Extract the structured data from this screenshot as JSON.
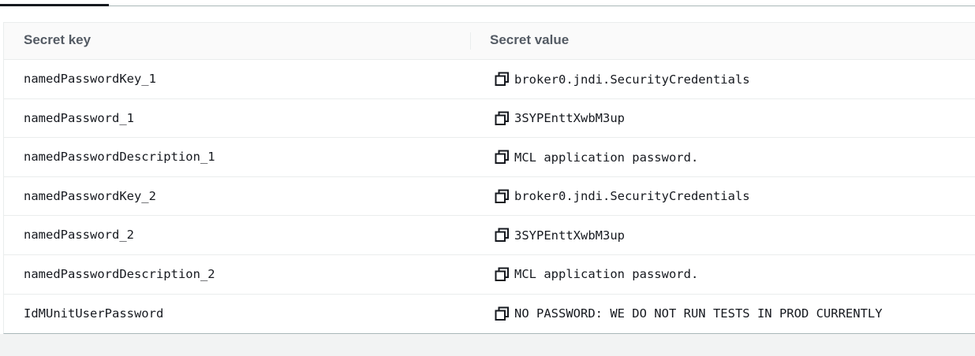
{
  "table": {
    "headers": {
      "key": "Secret key",
      "value": "Secret value"
    },
    "rows": [
      {
        "key": "namedPasswordKey_1",
        "value": "broker0.jndi.SecurityCredentials"
      },
      {
        "key": "namedPassword_1",
        "value": "3SYPEnttXwbM3up"
      },
      {
        "key": "namedPasswordDescription_1",
        "value": "MCL application password."
      },
      {
        "key": "namedPasswordKey_2",
        "value": "broker0.jndi.SecurityCredentials"
      },
      {
        "key": "namedPassword_2",
        "value": "3SYPEnttXwbM3up"
      },
      {
        "key": "namedPasswordDescription_2",
        "value": "MCL application password."
      },
      {
        "key": "IdMUnitUserPassword",
        "value": "NO PASSWORD: WE DO NOT RUN TESTS IN PROD CURRENTLY"
      }
    ]
  },
  "icons": {
    "copy": "copy-icon"
  },
  "colors": {
    "text": "#16191f",
    "header_text": "#545b64",
    "header_bg": "#fafafa",
    "row_border": "#eaeded",
    "panel_border": "#aab7b8"
  }
}
